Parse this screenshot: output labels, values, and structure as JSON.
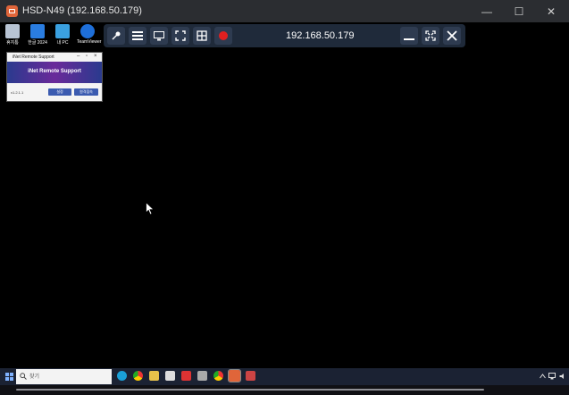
{
  "window": {
    "title": "HSD-N49 (192.168.50.179)",
    "minimize": "—",
    "maximize": "☐",
    "close": "✕"
  },
  "desktop_icons": [
    {
      "label": "휴지통",
      "icon": "recycle-bin-icon",
      "color": "#b8c4d4"
    },
    {
      "label": "한글 2024",
      "icon": "hangul-icon",
      "color": "#2a7de1"
    },
    {
      "label": "내 PC",
      "icon": "monitor-icon",
      "color": "#3aa0e0"
    },
    {
      "label": "TeamViewer",
      "icon": "teamviewer-icon",
      "color": "#1e6fd9"
    }
  ],
  "toolbar": {
    "ip": "192.168.50.179",
    "buttons": [
      "pin-icon",
      "menu-icon",
      "monitor-icon",
      "fullscreen-icon",
      "grid-icon",
      "record-icon",
      "minimize-icon",
      "expand-icon",
      "close-icon"
    ],
    "record_color": "#e02020",
    "bg_color": "#1f2a3a"
  },
  "remote_window": {
    "title": "iNet Remote Support",
    "brand": "iNet Remote Support",
    "version": "v1.2.1.1",
    "buttons": [
      "설정",
      "원격접속"
    ]
  },
  "taskbar": {
    "search_placeholder": "찾기",
    "apps": [
      "edge-icon",
      "chrome-icon",
      "explorer-icon",
      "store-icon",
      "app-red-icon",
      "app-gray-icon",
      "chrome-icon-2",
      "remote-app-icon",
      "app-v-icon"
    ]
  }
}
